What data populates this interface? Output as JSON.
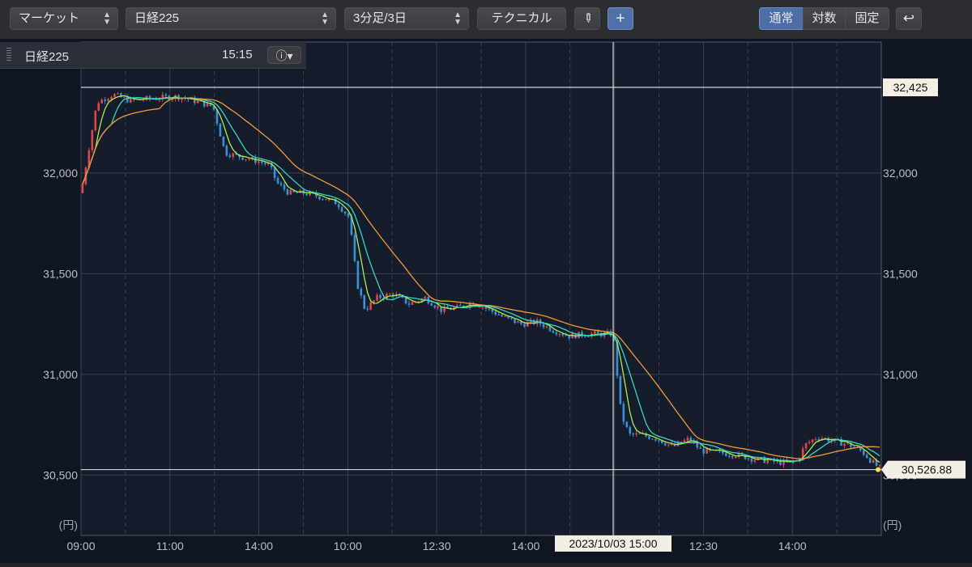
{
  "toolbar": {
    "market_label": "マーケット",
    "symbol_label": "日経225",
    "period_label": "3分足/3日",
    "technical_label": "テクニカル",
    "scale_modes": [
      "通常",
      "対数",
      "固定"
    ],
    "active_scale": "通常"
  },
  "legend": {
    "name": "日経225",
    "time": "15:15"
  },
  "colors": {
    "background": "#151d2c",
    "grid": "#3a4252",
    "up": "#e0454a",
    "down": "#3b8fd6",
    "ma_short": "#a6f04a",
    "ma_mid": "#34d7c2",
    "ma_long": "#f39a33",
    "crosshair": "#ffffff"
  },
  "chart_data": {
    "type": "candlestick",
    "unit_label": "(円)",
    "ylim": [
      30200,
      32650
    ],
    "y_ticks": [
      30500,
      31000,
      31500,
      32000
    ],
    "y_tick_labels": [
      "30,500",
      "31,000",
      "31,500",
      "32,000"
    ],
    "x_tick_labels": [
      "09:00",
      "11:00",
      "14:00",
      "10:00",
      "12:30",
      "14:00",
      "",
      "12:30",
      "14:00"
    ],
    "crosshair": {
      "date_label": "2023/10/03 15:00",
      "price_label": "32,425",
      "price": 32425
    },
    "last_price": {
      "label": "30,526.88",
      "value": 30526.88
    },
    "price_path": [
      [
        0.0,
        31900
      ],
      [
        0.02,
        32350
      ],
      [
        0.04,
        32390
      ],
      [
        0.06,
        32360
      ],
      [
        0.09,
        32370
      ],
      [
        0.12,
        32380
      ],
      [
        0.14,
        32360
      ],
      [
        0.165,
        32330
      ],
      [
        0.18,
        32100
      ],
      [
        0.2,
        32080
      ],
      [
        0.22,
        32060
      ],
      [
        0.235,
        32040
      ],
      [
        0.245,
        31950
      ],
      [
        0.26,
        31900
      ],
      [
        0.28,
        31900
      ],
      [
        0.3,
        31880
      ],
      [
        0.32,
        31850
      ],
      [
        0.335,
        31780
      ],
      [
        0.345,
        31450
      ],
      [
        0.355,
        31320
      ],
      [
        0.37,
        31380
      ],
      [
        0.39,
        31400
      ],
      [
        0.41,
        31350
      ],
      [
        0.43,
        31380
      ],
      [
        0.45,
        31320
      ],
      [
        0.47,
        31330
      ],
      [
        0.49,
        31360
      ],
      [
        0.51,
        31320
      ],
      [
        0.53,
        31280
      ],
      [
        0.55,
        31250
      ],
      [
        0.57,
        31260
      ],
      [
        0.59,
        31220
      ],
      [
        0.61,
        31190
      ],
      [
        0.63,
        31200
      ],
      [
        0.665,
        31200
      ],
      [
        0.675,
        30800
      ],
      [
        0.685,
        30700
      ],
      [
        0.7,
        30700
      ],
      [
        0.72,
        30680
      ],
      [
        0.74,
        30640
      ],
      [
        0.76,
        30680
      ],
      [
        0.775,
        30620
      ],
      [
        0.8,
        30610
      ],
      [
        0.82,
        30600
      ],
      [
        0.84,
        30580
      ],
      [
        0.86,
        30570
      ],
      [
        0.88,
        30560
      ],
      [
        0.895,
        30570
      ],
      [
        0.905,
        30650
      ],
      [
        0.92,
        30690
      ],
      [
        0.94,
        30670
      ],
      [
        0.96,
        30650
      ],
      [
        0.975,
        30620
      ],
      [
        0.99,
        30560
      ],
      [
        1.0,
        30527
      ]
    ]
  }
}
